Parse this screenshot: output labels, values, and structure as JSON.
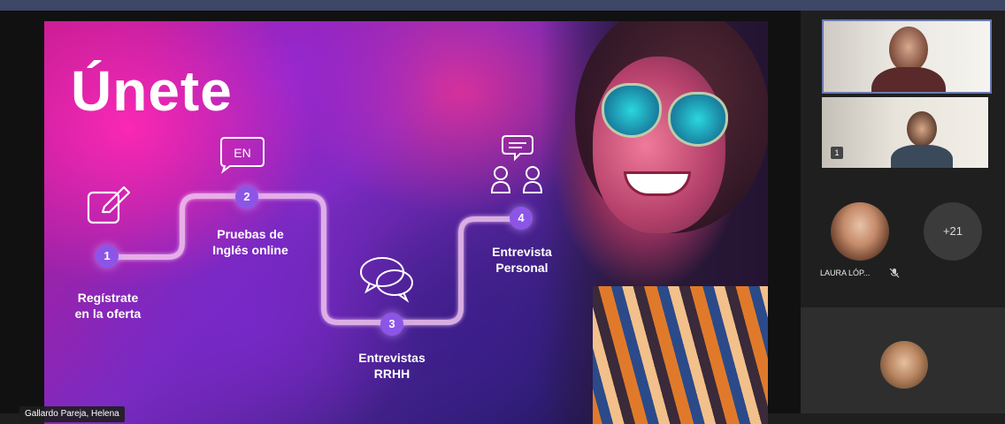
{
  "slide": {
    "title": "Únete",
    "steps": [
      {
        "number": "1",
        "label_line1": "Regístrate",
        "label_line2": "en la oferta",
        "icon": "edit-icon"
      },
      {
        "number": "2",
        "label_line1": "Pruebas de",
        "label_line2": "Inglés online",
        "icon": "english-test-icon",
        "icon_text": "EN"
      },
      {
        "number": "3",
        "label_line1": "Entrevistas",
        "label_line2": "RRHH",
        "icon": "chat-bubbles-icon"
      },
      {
        "number": "4",
        "label_line1": "Entrevista",
        "label_line2": "Personal",
        "icon": "interview-people-icon"
      }
    ]
  },
  "presenter_name": "Gallardo Pareja, Helena",
  "participants": {
    "participant_name": "LAURA LÓP...",
    "more_count": "+21",
    "video_badge": "1"
  },
  "colors": {
    "accent_purple": "#8c55e6",
    "active_video_border": "#6a7ab3",
    "panel_bg": "#1f1f1f"
  }
}
